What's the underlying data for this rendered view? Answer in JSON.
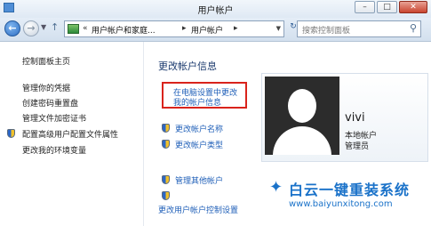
{
  "window": {
    "title": "用户帐户",
    "controls": {
      "minimize": "–",
      "maximize": "□",
      "close": "✕"
    }
  },
  "nav": {
    "back_icon": "left-arrow",
    "forward_icon": "right-arrow",
    "dropdown": "▼",
    "up": "↑",
    "breadcrumb": {
      "sep1": "«",
      "crumb1": "用户帐户和家庭...",
      "sep2": "▸",
      "crumb2": "用户帐户",
      "sep3": "▸"
    },
    "refresh": "↻",
    "search_placeholder": "搜索控制面板",
    "search_icon": "⚲"
  },
  "sidebar": {
    "items": [
      {
        "label": "控制面板主页"
      },
      {
        "label": "管理你的凭据"
      },
      {
        "label": "创建密码重置盘"
      },
      {
        "label": "管理文件加密证书"
      },
      {
        "label": "配置高级用户配置文件属性"
      },
      {
        "label": "更改我的环境变量"
      }
    ]
  },
  "main": {
    "title": "更改帐户信息",
    "pc_settings_link": {
      "line1": "在电脑设置中更改",
      "line2": "我的帐户信息"
    },
    "tasks": [
      {
        "label": "更改帐户名称"
      },
      {
        "label": "更改帐户类型"
      },
      {
        "label": "管理其他帐户"
      },
      {
        "label": "更改用户帐户控制设置"
      }
    ],
    "user": {
      "name": "vivi",
      "account_type": "本地帐户",
      "role": "管理员"
    }
  },
  "watermark": {
    "title": "白云一键重装系统",
    "url": "www.baiyunxitong.com"
  },
  "colors": {
    "accent": "#1a72c9",
    "link": "#1f5fb8",
    "highlight_border": "#d9231c"
  }
}
